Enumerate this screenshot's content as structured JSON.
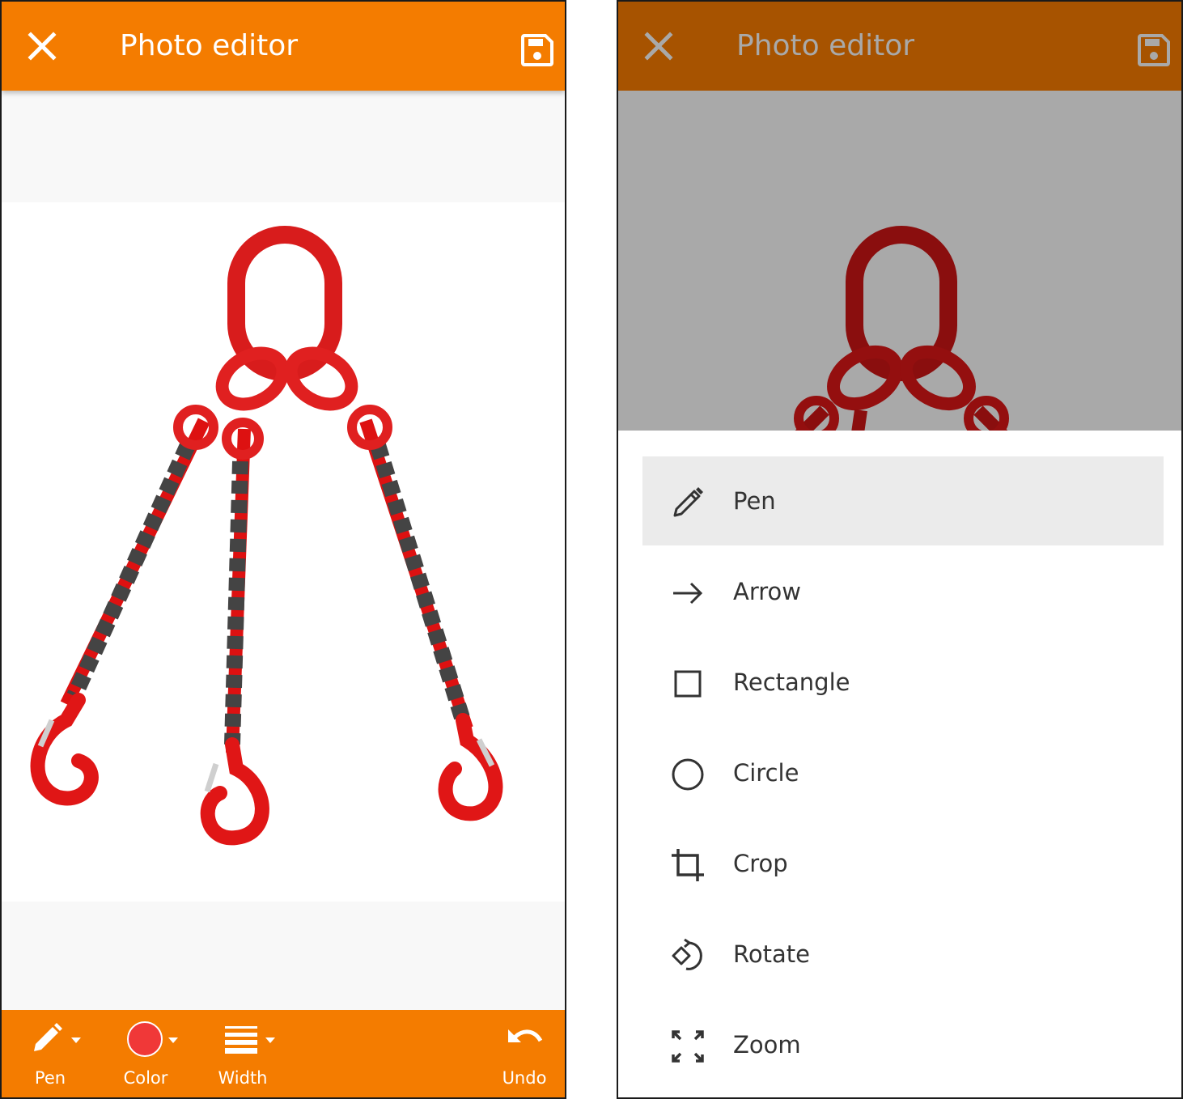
{
  "colors": {
    "accent": "#f47c00",
    "accent_dimmed": "#a75300",
    "selected_color_swatch": "#f03838",
    "dim_overlay": "#a9a9a9",
    "menu_selected_bg": "#ebebeb"
  },
  "editor": {
    "title": "Photo editor",
    "close_icon": "close-icon",
    "save_icon": "save-icon"
  },
  "toolbar": {
    "pen_label": "Pen",
    "color_label": "Color",
    "width_label": "Width",
    "undo_label": "Undo"
  },
  "menu": {
    "items": [
      {
        "label": "Pen",
        "icon": "pencil-icon",
        "selected": true
      },
      {
        "label": "Arrow",
        "icon": "arrow-right-icon",
        "selected": false
      },
      {
        "label": "Rectangle",
        "icon": "square-icon",
        "selected": false
      },
      {
        "label": "Circle",
        "icon": "circle-icon",
        "selected": false
      },
      {
        "label": "Crop",
        "icon": "crop-icon",
        "selected": false
      },
      {
        "label": "Rotate",
        "icon": "rotate-icon",
        "selected": false
      },
      {
        "label": "Zoom",
        "icon": "fullscreen-icon",
        "selected": false
      }
    ]
  }
}
